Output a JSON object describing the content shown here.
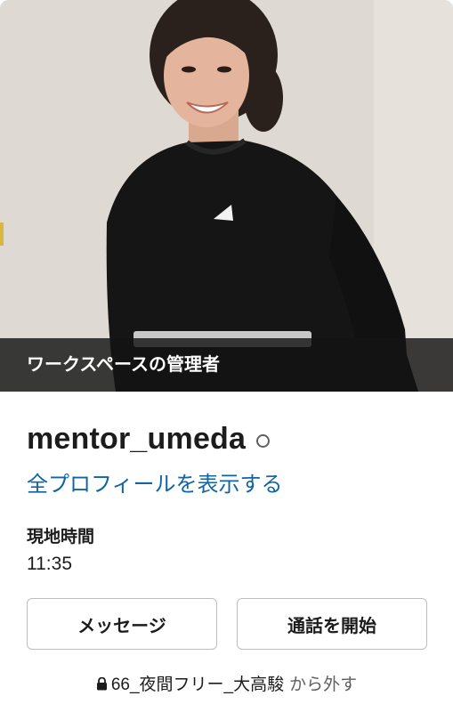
{
  "profile": {
    "role_banner": "ワークスペースの管理者",
    "name": "mentor_umeda",
    "presence": "away",
    "full_profile_link": "全プロフィールを表示する",
    "local_time_label": "現地時間",
    "local_time_value": "11:35"
  },
  "actions": {
    "message_label": "メッセージ",
    "call_label": "通話を開始"
  },
  "footer": {
    "channel_name": "66_夜間フリー_大高駿",
    "remove_label": "から外す"
  },
  "icons": {
    "presence": "presence-away-icon",
    "lock": "lock-icon"
  },
  "colors": {
    "link": "#1264a3",
    "text": "#1d1c1d",
    "muted": "#616061",
    "banner_bg": "#141414"
  }
}
